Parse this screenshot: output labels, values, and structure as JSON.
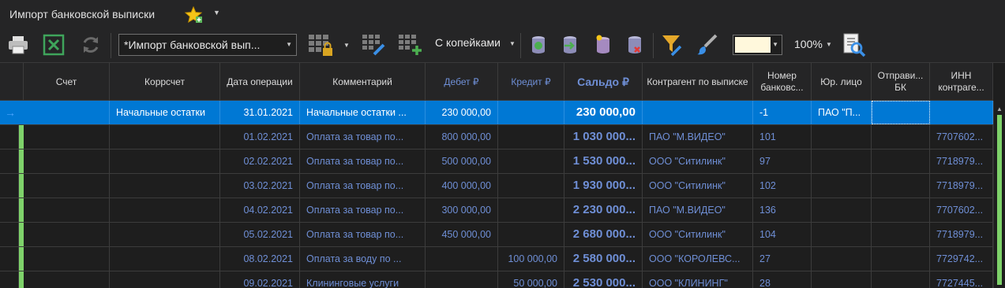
{
  "window": {
    "title": "Импорт банковской выписки"
  },
  "toolbar": {
    "preset_value": "*Импорт банковской вып...",
    "kopeyki_label": "С копейками",
    "zoom_label": "100%",
    "highlight_color": "#fff8dc"
  },
  "columns": [
    {
      "label": "Счет"
    },
    {
      "label": "Коррсчет"
    },
    {
      "label": "Дата операции"
    },
    {
      "label": "Комментарий"
    },
    {
      "label": "Дебет ₽"
    },
    {
      "label": "Кредит ₽"
    },
    {
      "label": "Сальдо ₽"
    },
    {
      "label": "Контрагент по выписке"
    },
    {
      "label": "Номер банковс..."
    },
    {
      "label": "Юр. лицо"
    },
    {
      "label": "Отправи... БК"
    },
    {
      "label": "ИНН контраге..."
    }
  ],
  "rows": [
    {
      "schet": "",
      "korr": "Начальные остатки",
      "date": "31.01.2021",
      "comment": "Начальные остатки ...",
      "debet": "230 000,00",
      "kredit": "",
      "saldo": "230 000,00",
      "kontragent": "",
      "nomer": "-1",
      "yur": "ПАО \"П...",
      "otpr": "",
      "inn": ""
    },
    {
      "schet": "",
      "korr": "",
      "date": "01.02.2021",
      "comment": "Оплата за товар по...",
      "debet": "800 000,00",
      "kredit": "",
      "saldo": "1 030 000...",
      "kontragent": "ПАО \"М.ВИДЕО\"",
      "nomer": "101",
      "yur": "",
      "otpr": "",
      "inn": "7707602..."
    },
    {
      "schet": "",
      "korr": "",
      "date": "02.02.2021",
      "comment": "Оплата за товар по...",
      "debet": "500 000,00",
      "kredit": "",
      "saldo": "1 530 000...",
      "kontragent": "ООО \"Ситилинк\"",
      "nomer": "97",
      "yur": "",
      "otpr": "",
      "inn": "7718979..."
    },
    {
      "schet": "",
      "korr": "",
      "date": "03.02.2021",
      "comment": "Оплата за товар по...",
      "debet": "400 000,00",
      "kredit": "",
      "saldo": "1 930 000...",
      "kontragent": "ООО \"Ситилинк\"",
      "nomer": "102",
      "yur": "",
      "otpr": "",
      "inn": "7718979..."
    },
    {
      "schet": "",
      "korr": "",
      "date": "04.02.2021",
      "comment": "Оплата за товар по...",
      "debet": "300 000,00",
      "kredit": "",
      "saldo": "2 230 000...",
      "kontragent": "ПАО \"М.ВИДЕО\"",
      "nomer": "136",
      "yur": "",
      "otpr": "",
      "inn": "7707602..."
    },
    {
      "schet": "",
      "korr": "",
      "date": "05.02.2021",
      "comment": "Оплата за товар по...",
      "debet": "450 000,00",
      "kredit": "",
      "saldo": "2 680 000...",
      "kontragent": "ООО \"Ситилинк\"",
      "nomer": "104",
      "yur": "",
      "otpr": "",
      "inn": "7718979..."
    },
    {
      "schet": "",
      "korr": "",
      "date": "08.02.2021",
      "comment": "Оплата за воду по ...",
      "debet": "",
      "kredit": "100 000,00",
      "saldo": "2 580 000...",
      "kontragent": "ООО \"КОРОЛЕВС...",
      "nomer": "27",
      "yur": "",
      "otpr": "",
      "inn": "7729742..."
    },
    {
      "schet": "",
      "korr": "",
      "date": "09.02.2021",
      "comment": "Клининговые услуги",
      "debet": "",
      "kredit": "50 000,00",
      "saldo": "2 530 000...",
      "kontragent": "ООО \"КЛИНИНГ\"",
      "nomer": "28",
      "yur": "",
      "otpr": "",
      "inn": "7727445..."
    }
  ]
}
